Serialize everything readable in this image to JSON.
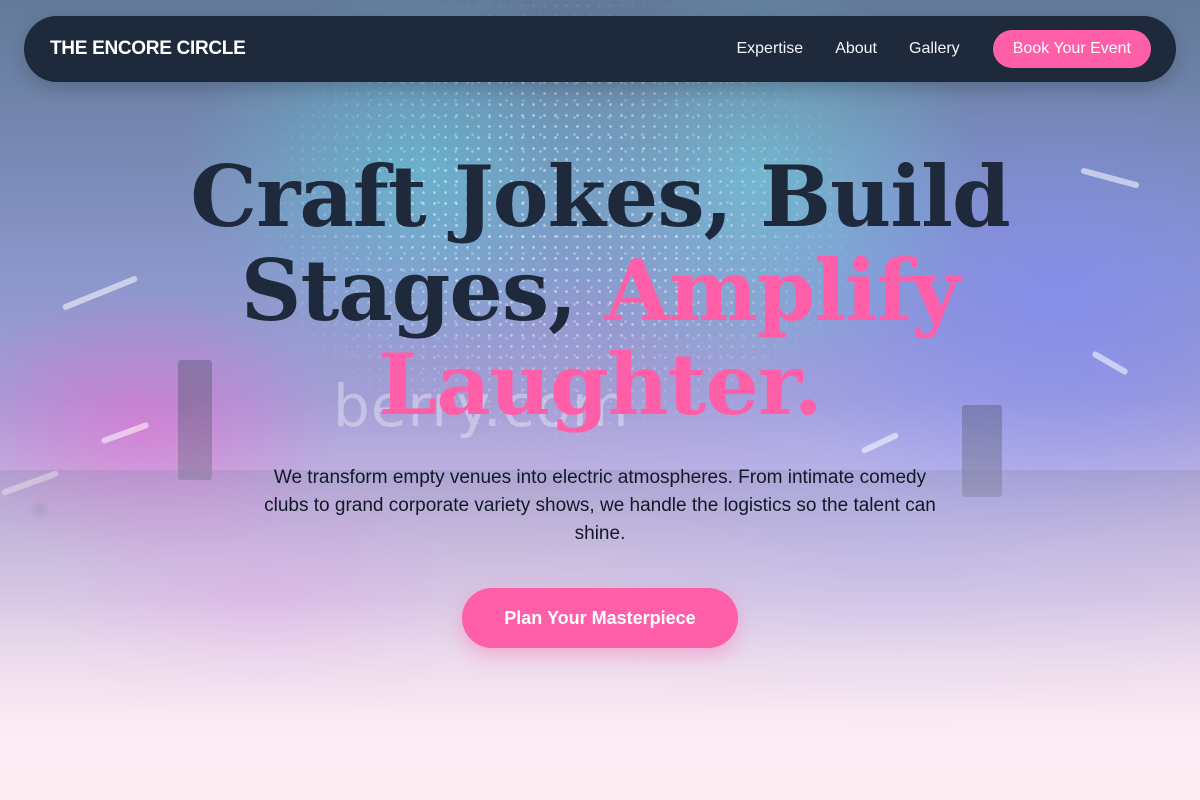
{
  "nav": {
    "brand": "THE ENCORE CIRCLE",
    "links": [
      "Expertise",
      "About",
      "Gallery"
    ],
    "cta_label": "Book Your Event"
  },
  "hero": {
    "title_part1": "Craft Jokes, Build Stages, ",
    "title_accent": "Amplify Laughter.",
    "subtitle": "We transform empty venues into electric atmospheres. From intimate comedy clubs to grand corporate variety shows, we handle the logistics so the talent can shine.",
    "cta_label": "Plan Your Masterpiece"
  },
  "background": {
    "watermark": "berry.com"
  },
  "colors": {
    "accent": "#ff5fa8",
    "navy": "#1e293b"
  }
}
